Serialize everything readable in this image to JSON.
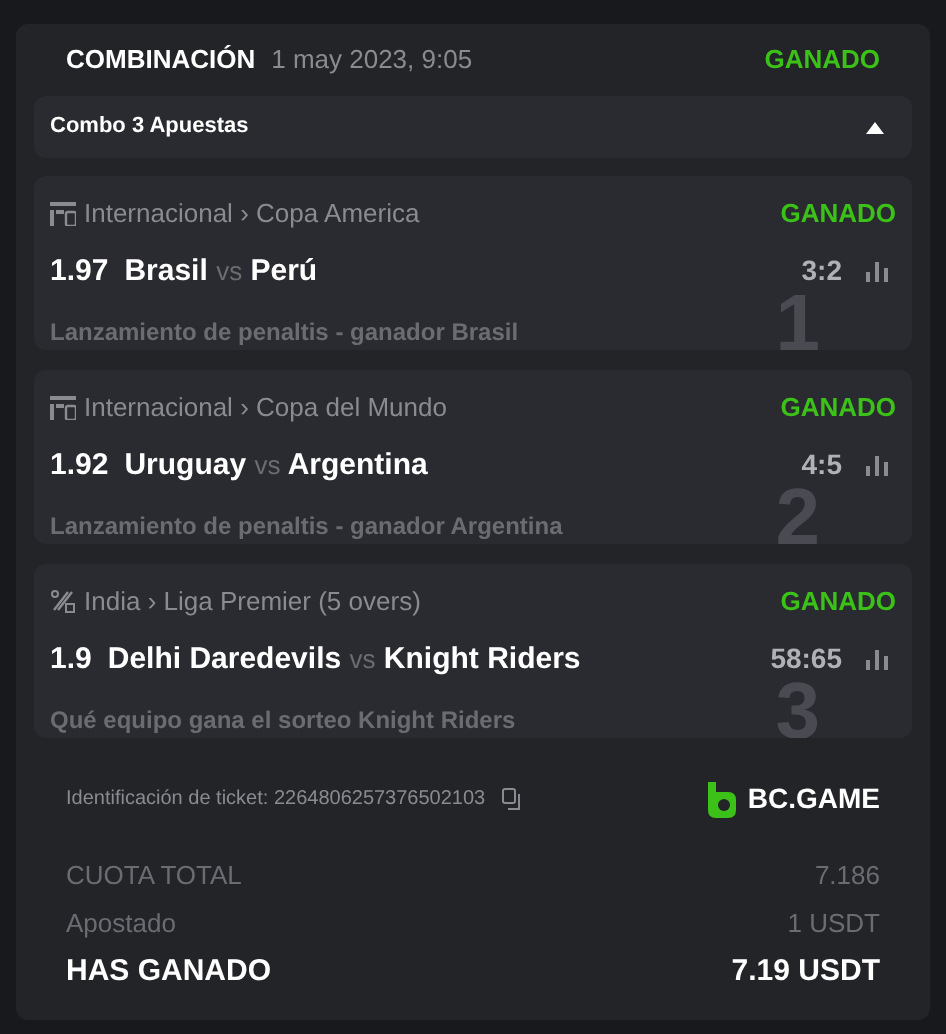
{
  "header": {
    "title": "COMBINACIÓN",
    "date": "1 may 2023, 9:05",
    "status": "GANADO"
  },
  "combo": {
    "label": "Combo 3 Apuestas",
    "expanded": true
  },
  "bets": [
    {
      "number": "1",
      "kind": "fifa",
      "country": "Internacional",
      "separator": "›",
      "league": "Copa America",
      "status": "GANADO",
      "odds": "1.97",
      "home": "Brasil",
      "vs": "vs",
      "away": "Perú",
      "score": "3:2",
      "market": "Lanzamiento de penaltis - ganador Brasil"
    },
    {
      "number": "2",
      "kind": "fifa",
      "country": "Internacional",
      "separator": "›",
      "league": "Copa del Mundo",
      "status": "GANADO",
      "odds": "1.92",
      "home": "Uruguay",
      "vs": "vs",
      "away": "Argentina",
      "score": "4:5",
      "market": "Lanzamiento de penaltis - ganador Argentina"
    },
    {
      "number": "3",
      "kind": "cricket",
      "country": "India",
      "separator": "›",
      "league": "Liga Premier (5 overs)",
      "status": "GANADO",
      "odds": "1.9",
      "home": "Delhi Daredevils",
      "vs": "vs",
      "away": "Knight Riders",
      "score": "58:65",
      "market": "Qué equipo gana el sorteo Knight Riders"
    }
  ],
  "ticket": {
    "label": "Identificación de ticket: 2264806257376502103",
    "brand": "BC.GAME"
  },
  "totals": [
    {
      "kind": "plain",
      "label": "CUOTA TOTAL",
      "value": "7.186"
    },
    {
      "kind": "plain",
      "label": "Apostado",
      "value": "1 USDT"
    },
    {
      "kind": "strong",
      "label": "HAS GANADO",
      "value": "7.19 USDT"
    }
  ]
}
